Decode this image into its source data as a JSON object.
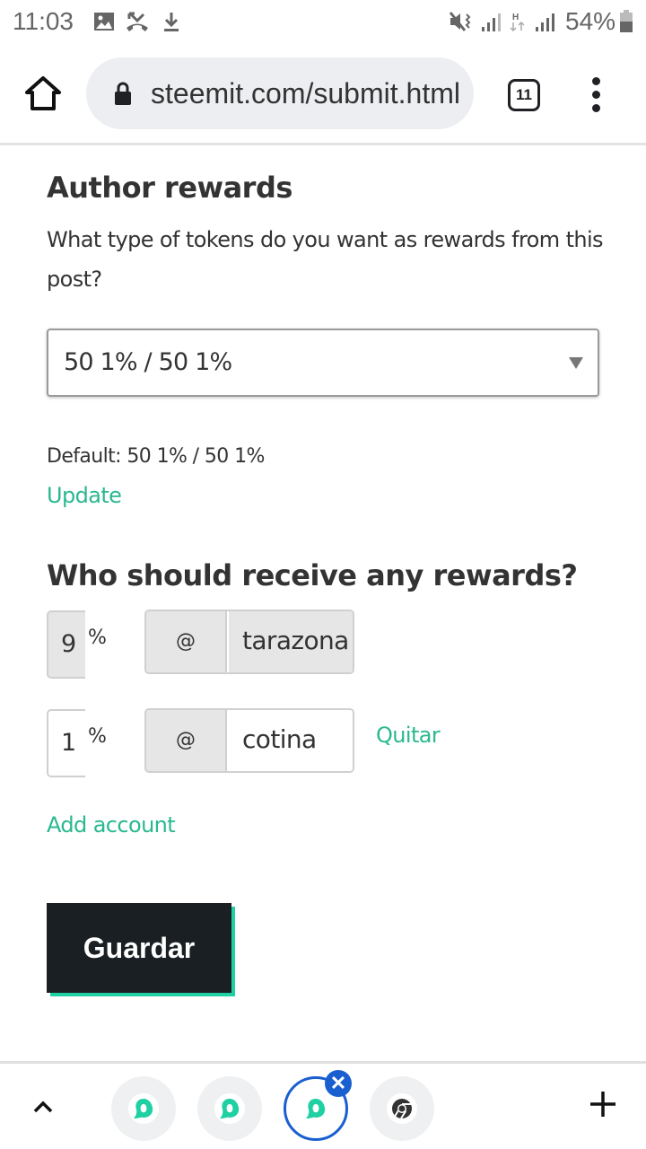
{
  "status_bar": {
    "time": "11:03",
    "notification_icons": [
      "image-icon",
      "missed-call-icon",
      "download-icon"
    ],
    "system_icons": [
      "vibrate-mute-icon",
      "signal-icon",
      "hspa-data-icon",
      "signal-icon"
    ],
    "battery_percent": "54%"
  },
  "browser": {
    "url": "steemit.com/submit.html",
    "tab_count": "11"
  },
  "author_rewards": {
    "title": "Author rewards",
    "description": "What type of tokens do you want as rewards from this post?",
    "selected_option": "50 1% / 50 1%",
    "default_label": "Default: 50 1% / 50 1%",
    "update_link": "Update"
  },
  "beneficiaries": {
    "title": "Who should receive any rewards?",
    "rows": [
      {
        "percent": "9",
        "percent_sign": "%",
        "at_sign": "@",
        "account": "tarazona",
        "disabled": true,
        "remove_label": ""
      },
      {
        "percent": "1",
        "percent_sign": "%",
        "at_sign": "@",
        "account": "cotina",
        "disabled": false,
        "remove_label": "Quitar"
      }
    ],
    "add_account_link": "Add account"
  },
  "save_button": "Guardar",
  "tab_strip": {
    "tabs": [
      {
        "favicon": "steemit-icon",
        "active": false
      },
      {
        "favicon": "steemit-icon",
        "active": false
      },
      {
        "favicon": "steemit-icon",
        "active": true
      },
      {
        "favicon": "chrome-icon",
        "active": false
      }
    ],
    "close_glyph": "✕"
  },
  "colors": {
    "accent_green": "#2ab88f",
    "button_dark": "#1a1f24",
    "button_shadow": "#1fd0a3",
    "active_tab_blue": "#1a5fd0"
  }
}
